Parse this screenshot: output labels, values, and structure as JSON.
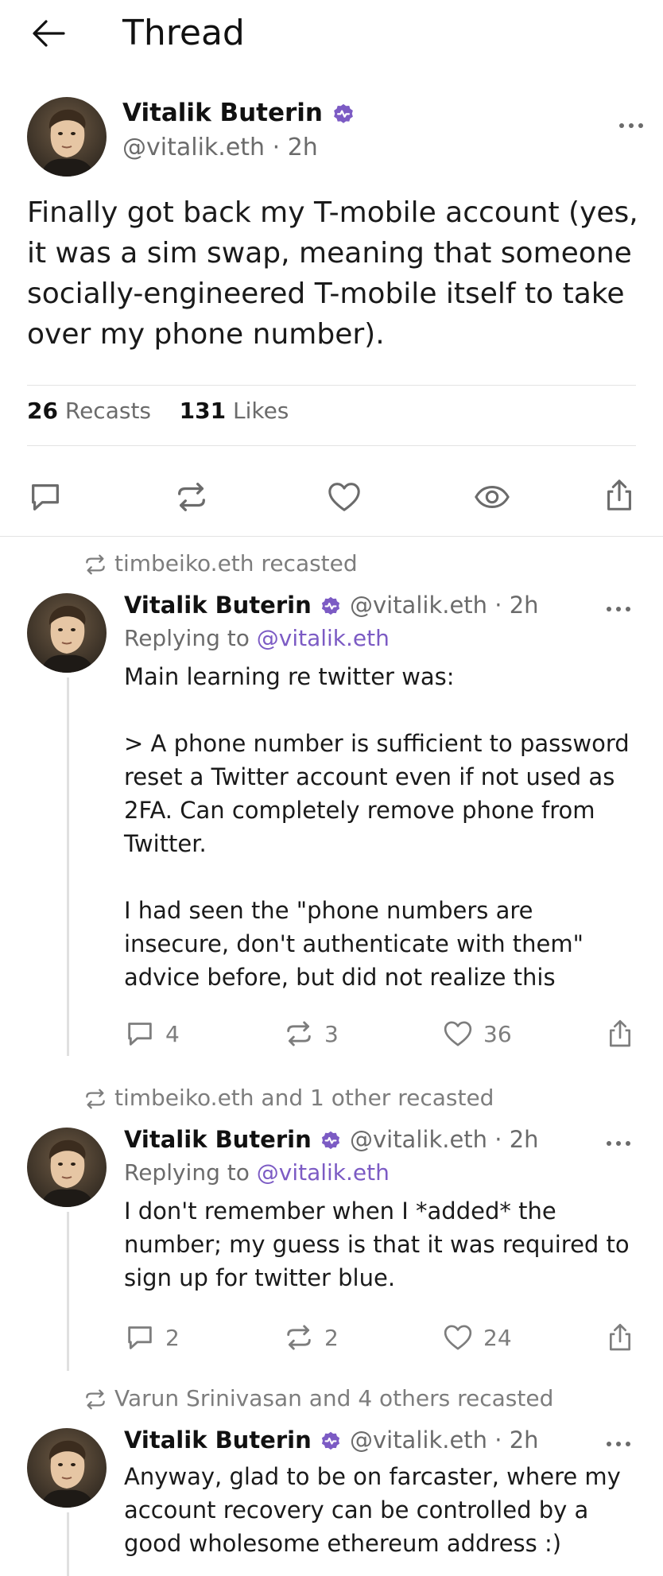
{
  "header": {
    "title": "Thread"
  },
  "main_post": {
    "author": "Vitalik Buterin",
    "handle": "@vitalik.eth",
    "time": "2h",
    "text": "Finally got back my T-mobile account (yes, it was a sim swap, meaning that someone socially-engineered T-mobile itself to take over my phone number).",
    "recasts_count": "26",
    "recasts_label": "Recasts",
    "likes_count": "131",
    "likes_label": "Likes"
  },
  "replies": [
    {
      "recast_by": "timbeiko.eth recasted",
      "author": "Vitalik Buterin",
      "handle": "@vitalik.eth",
      "time": "2h",
      "replying_prefix": "Replying to",
      "replying_to": "@vitalik.eth",
      "paragraphs": [
        "Main learning re twitter was:",
        "> A phone number is sufficient to password reset a Twitter account even if not used as 2FA. Can completely remove phone from Twitter.",
        "I had seen the \"phone numbers are insecure, don't authenticate with them\" advice before, but did not realize this"
      ],
      "replies": "4",
      "recasts": "3",
      "likes": "36"
    },
    {
      "recast_by": "timbeiko.eth and 1 other recasted",
      "author": "Vitalik Buterin",
      "handle": "@vitalik.eth",
      "time": "2h",
      "replying_prefix": "Replying to",
      "replying_to": "@vitalik.eth",
      "paragraphs": [
        "I don't remember when I *added* the number; my guess is that it was required to sign up for twitter blue."
      ],
      "replies": "2",
      "recasts": "2",
      "likes": "24"
    },
    {
      "recast_by": "Varun Srinivasan and 4 others recasted",
      "author": "Vitalik Buterin",
      "handle": "@vitalik.eth",
      "time": "2h",
      "paragraphs": [
        "Anyway, glad to be on farcaster, where my account recovery can be controlled by a good wholesome ethereum address :)"
      ]
    }
  ],
  "icons": {
    "back": "arrow-left-icon",
    "verified": "verified-badge-icon",
    "more": "more-horizontal-icon",
    "reply": "comment-icon",
    "recast": "recast-icon",
    "like": "heart-icon",
    "views": "eye-icon",
    "share": "share-icon"
  },
  "colors": {
    "verified": "#7c5bc4",
    "mention": "#7c5bc4",
    "muted": "#6b6b6b",
    "divider": "#e3e3e3"
  }
}
